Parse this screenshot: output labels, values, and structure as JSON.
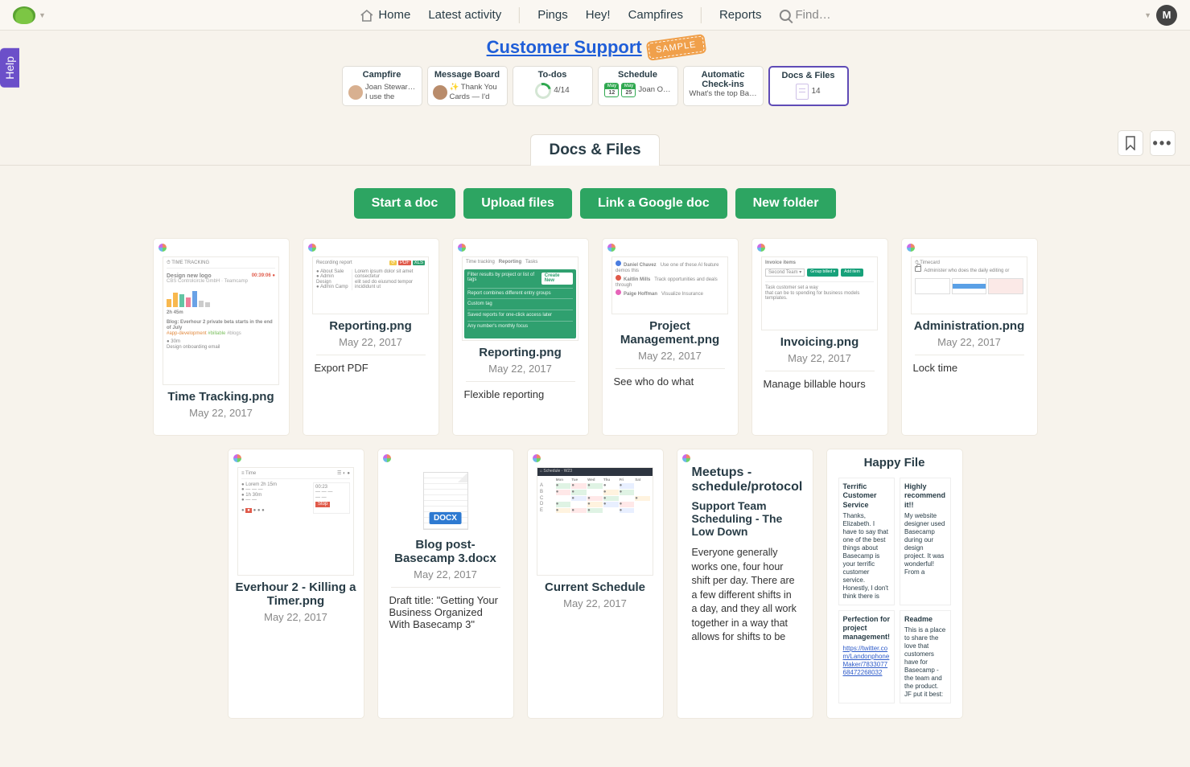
{
  "nav": {
    "home": "Home",
    "latest": "Latest activity",
    "pings": "Pings",
    "hey": "Hey!",
    "campfires": "Campfires",
    "reports": "Reports",
    "find": "Find…",
    "avatar_initial": "M"
  },
  "help_tab": "Help",
  "project": {
    "title": "Customer Support",
    "badge": "SAMPLE"
  },
  "tools": {
    "campfire": {
      "title": "Campfire",
      "person": "Joan Stewar…",
      "snippet": "I use the"
    },
    "message_board": {
      "title": "Message Board",
      "snippet": "✨ Thank You Cards — I'd"
    },
    "todos": {
      "title": "To-dos",
      "progress": "4/14"
    },
    "schedule": {
      "title": "Schedule",
      "month": "May",
      "d1": "12",
      "d2": "25",
      "person": "Joan O…"
    },
    "checkins": {
      "title_l1": "Automatic",
      "title_l2": "Check-ins",
      "snippet": "What's the top Ba…"
    },
    "docs": {
      "title": "Docs & Files",
      "count": "14"
    }
  },
  "section_title": "Docs & Files",
  "buttons": {
    "start_doc": "Start a doc",
    "upload": "Upload files",
    "gdoc": "Link a Google doc",
    "folder": "New folder"
  },
  "files": [
    {
      "name": "Time Tracking.png",
      "date": "May 22, 2017",
      "desc": ""
    },
    {
      "name": "Reporting.png",
      "date": "May 22, 2017",
      "desc": "Export PDF"
    },
    {
      "name": "Reporting.png",
      "date": "May 22, 2017",
      "desc": "Flexible reporting"
    },
    {
      "name": "Project Management.png",
      "date": "May 22, 2017",
      "desc": "See who do what"
    },
    {
      "name": "Invoicing.png",
      "date": "May 22, 2017",
      "desc": "Manage billable hours"
    },
    {
      "name": "Administration.png",
      "date": "May 22, 2017",
      "desc": "Lock time"
    },
    {
      "name": "Everhour 2 - Killing a Timer.png",
      "date": "May 22, 2017",
      "desc": ""
    },
    {
      "name": "Blog post- Basecamp 3.docx",
      "date": "May 22, 2017",
      "desc": "Draft title: \"Getting Your Business Organized With Basecamp 3\"",
      "badge": "DOCX"
    },
    {
      "name": "Current Schedule",
      "date": "May 22, 2017",
      "desc": ""
    }
  ],
  "meetups": {
    "h1": "Meetups - schedule/protocol",
    "h2": "Support Team Scheduling - The Low Down",
    "body": "Everyone generally works one, four hour shift per day. There are a few different shifts in a day, and they all work together in a way that allows for shifts to be"
  },
  "happy": {
    "title": "Happy File",
    "tiles": [
      {
        "head": "Terrific Customer Service",
        "body": "Thanks, Elizabeth. I have to say that one of the best things about Basecamp is your terrific customer service. Honestly, I don't think there is"
      },
      {
        "head": "Highly recommend it!!",
        "body": "My website designer used Basecamp during our design project. It was wonderful! From a"
      },
      {
        "head": "Perfection for project management!",
        "body": "",
        "link": "https://twitter.com/LandonphoneMaker/783307768472268032"
      },
      {
        "head": "Readme",
        "body": "This is a place to share the love that customers have for Basecamp - the team and the product.\nJF put it best:"
      }
    ]
  }
}
